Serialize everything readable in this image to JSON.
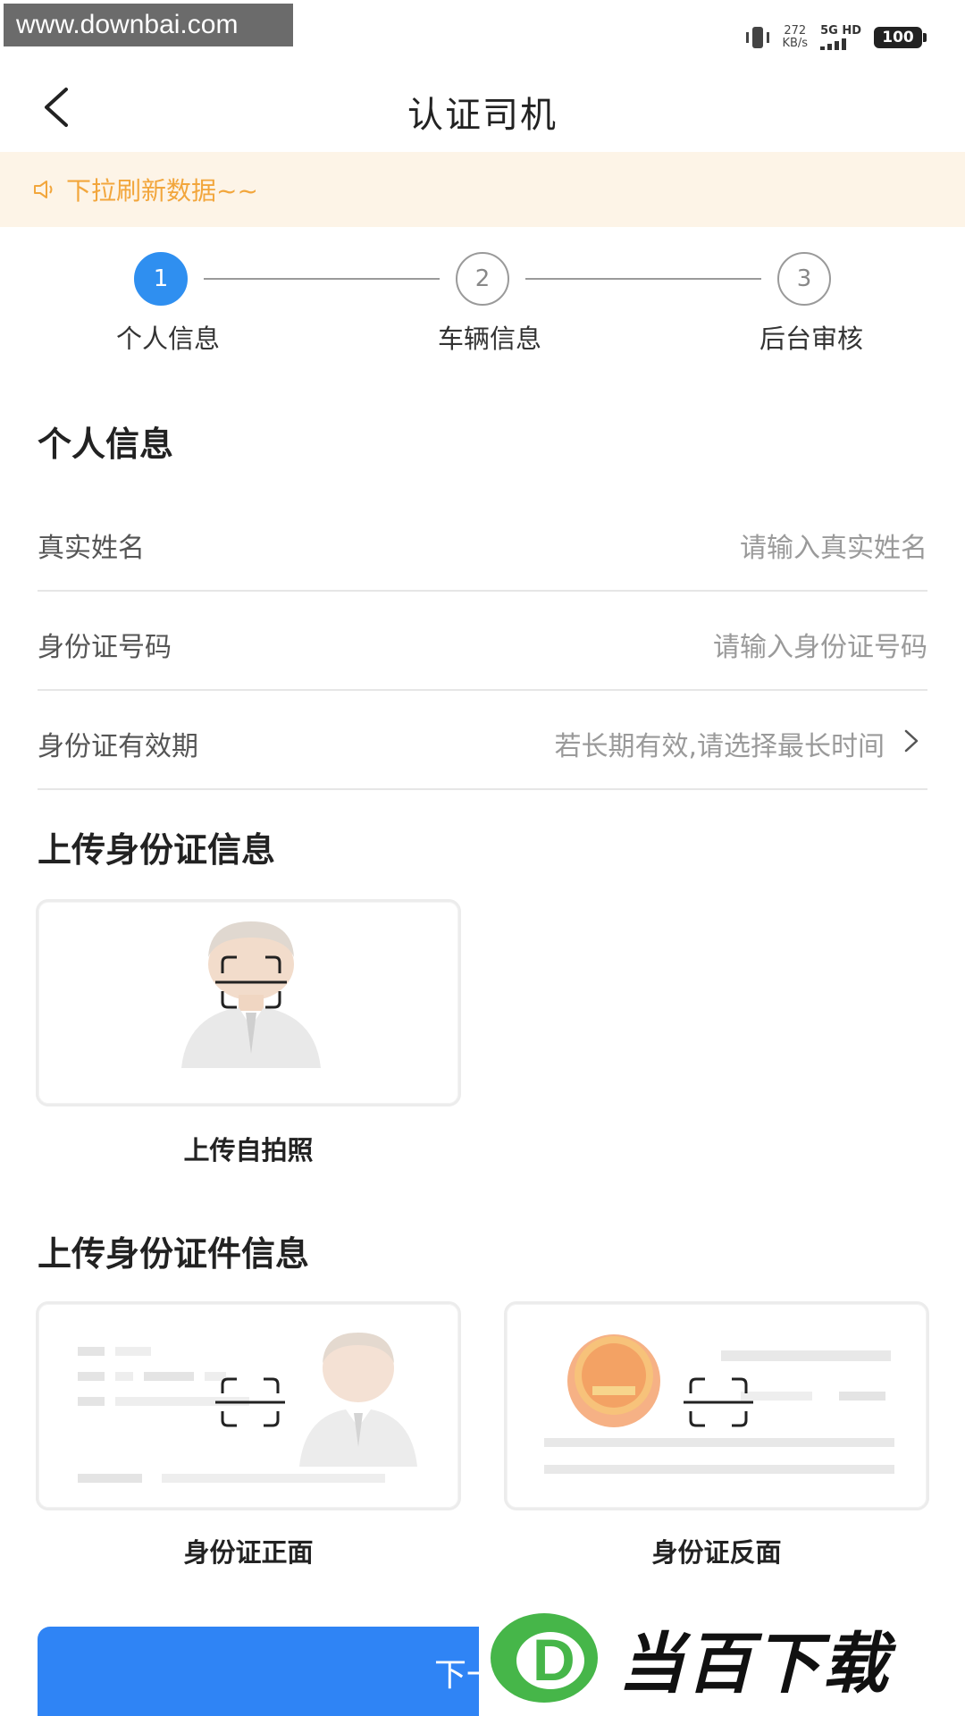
{
  "statusbar": {
    "watermark_url": "www.downbai.com",
    "net_speed_value": "272",
    "net_speed_unit": "KB/s",
    "network": "5G HD",
    "battery": "100"
  },
  "navbar": {
    "title": "认证司机"
  },
  "notice": {
    "text": "下拉刷新数据~~"
  },
  "steps": [
    {
      "number": "1",
      "label": "个人信息",
      "active": true
    },
    {
      "number": "2",
      "label": "车辆信息",
      "active": false
    },
    {
      "number": "3",
      "label": "后台审核",
      "active": false
    }
  ],
  "personal_section": {
    "title": "个人信息",
    "fields": [
      {
        "label": "真实姓名",
        "placeholder": "请输入真实姓名"
      },
      {
        "label": "身份证号码",
        "placeholder": "请输入身份证号码"
      },
      {
        "label": "身份证有效期",
        "placeholder": "若长期有效,请选择最长时间"
      }
    ]
  },
  "upload_id_section": {
    "title": "上传身份证信息",
    "selfie_caption": "上传自拍照"
  },
  "upload_doc_section": {
    "title": "上传身份证件信息",
    "front_caption": "身份证正面",
    "back_caption": "身份证反面"
  },
  "next_button": {
    "label": "下一步"
  },
  "watermark_bottom": {
    "text": "当百下载",
    "letter": "D"
  },
  "colors": {
    "accent": "#2f8ff0",
    "notice_bg": "#fdf4e7",
    "notice_text": "#f2a63c",
    "button": "#2f84f5"
  }
}
